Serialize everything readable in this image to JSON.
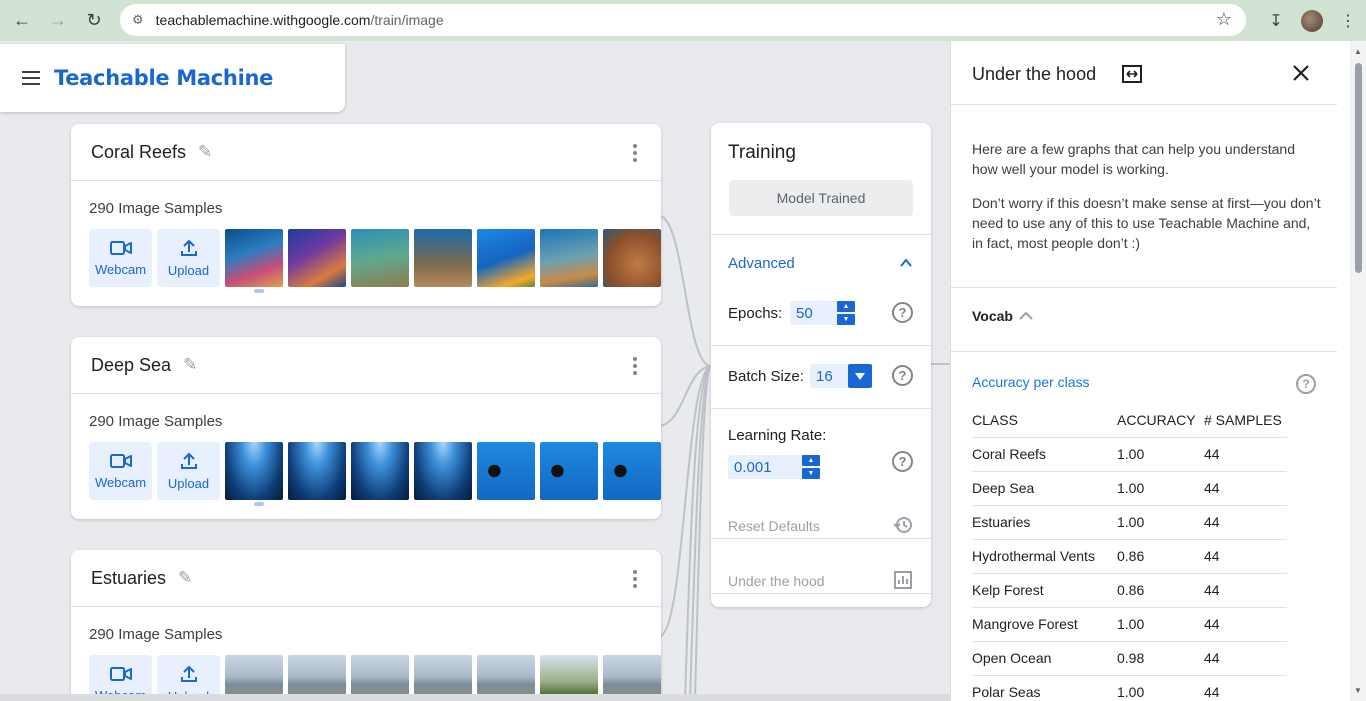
{
  "browser": {
    "url_host": "teachablemachine.withgoogle.com",
    "url_path": "/train/image"
  },
  "header": {
    "app_title": "Teachable Machine"
  },
  "classes": [
    {
      "name": "Coral Reefs",
      "samples": "290 Image Samples",
      "webcam_label": "Webcam",
      "upload_label": "Upload"
    },
    {
      "name": "Deep Sea",
      "samples": "290 Image Samples",
      "webcam_label": "Webcam",
      "upload_label": "Upload"
    },
    {
      "name": "Estuaries",
      "samples": "290 Image Samples",
      "webcam_label": "Webcam",
      "upload_label": "Upload"
    }
  ],
  "training": {
    "title": "Training",
    "trained_button": "Model Trained",
    "advanced_label": "Advanced",
    "epochs_label": "Epochs:",
    "epochs_value": "50",
    "batch_label": "Batch Size:",
    "batch_value": "16",
    "lr_label": "Learning Rate:",
    "lr_value": "0.001",
    "reset_label": "Reset Defaults",
    "hood_label": "Under the hood"
  },
  "panel": {
    "title": "Under the hood",
    "intro_1": "Here are a few graphs that can help you understand how well your model is working.",
    "intro_2": "Don’t worry if this doesn’t make sense at first—you don’t need to use any of this to use Teachable Machine and, in fact, most people don’t :)",
    "vocab_label": "Vocab",
    "accuracy_title": "Accuracy per class",
    "table_headers": [
      "CLASS",
      "ACCURACY",
      "# SAMPLES"
    ],
    "table_rows": [
      [
        "Coral Reefs",
        "1.00",
        "44"
      ],
      [
        "Deep Sea",
        "1.00",
        "44"
      ],
      [
        "Estuaries",
        "1.00",
        "44"
      ],
      [
        "Hydrothermal Vents",
        "0.86",
        "44"
      ],
      [
        "Kelp Forest",
        "0.86",
        "44"
      ],
      [
        "Mangrove Forest",
        "1.00",
        "44"
      ],
      [
        "Open Ocean",
        "0.98",
        "44"
      ],
      [
        "Polar Seas",
        "1.00",
        "44"
      ]
    ]
  },
  "colors": {
    "brand": "#1967d2",
    "accent_bg": "#e8f0fe",
    "chrome": "#d3e3d3"
  }
}
